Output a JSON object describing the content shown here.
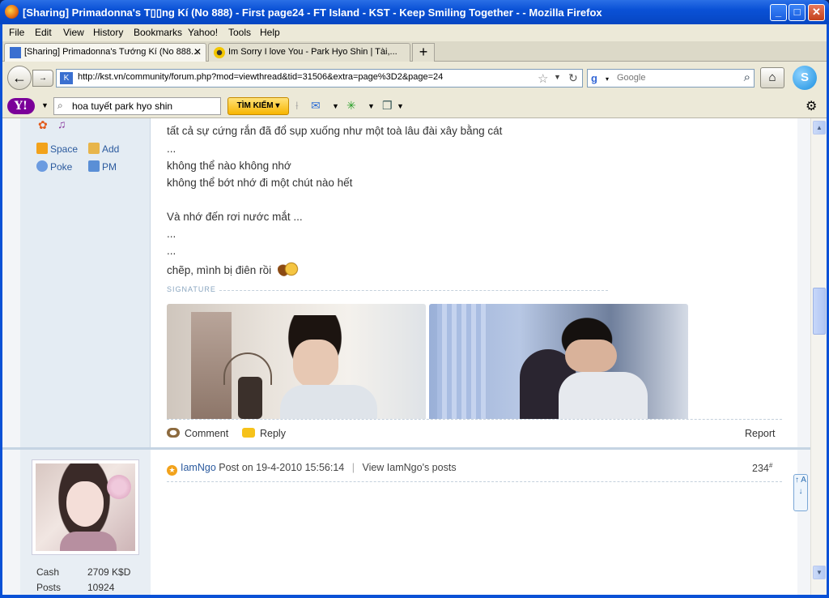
{
  "window": {
    "title": "[Sharing] Primadonna's T▯▯ng Kí (No 888) - First page24 - FT Island - KST - Keep Smiling Together - - Mozilla Firefox",
    "minimize": "_",
    "maximize": "□",
    "close": "✕"
  },
  "menu": [
    "File",
    "Edit",
    "View",
    "History",
    "Bookmarks",
    "Yahoo!",
    "Tools",
    "Help"
  ],
  "tabs": [
    {
      "label": "[Sharing] Primadonna's Tướng Kí (No 888...",
      "active": true
    },
    {
      "label": "Im Sorry I love You - Park Hyo Shin | Tài,...",
      "active": false
    }
  ],
  "nav": {
    "url": "http://kst.vn/community/forum.php?mod=viewthread&tid=31506&extra=page%3D2&page=24",
    "search_placeholder": "Google"
  },
  "yahoo": {
    "logo": "Y!",
    "search_value": "hoa tuyết park hyo shin",
    "search_button": "TÌM KIẾM ▾"
  },
  "sidebar": {
    "links": [
      {
        "label": "Space",
        "icon": "home-icon"
      },
      {
        "label": "Add",
        "icon": "handshake-icon"
      },
      {
        "label": "Poke",
        "icon": "poke-icon"
      },
      {
        "label": "PM",
        "icon": "mail-icon"
      }
    ]
  },
  "post": {
    "lines": [
      "tất cả sự cứng rắn đã đổ sụp xuống như một toà lâu đài xây bằng cát",
      "...",
      "không thể nào không nhớ",
      "không thể bớt nhớ đi một chút nào hết",
      "Và nhớ đến rơi nước mắt ...",
      "...",
      "...",
      "chẽp, mình bị điên rồi"
    ],
    "signature_label": "SIGNATURE",
    "actions": {
      "comment": "Comment",
      "reply": "Reply",
      "report": "Report"
    }
  },
  "next_post": {
    "author": "IamNgo",
    "posted": "Post on 19-4-2010 15:56:14",
    "view_posts": "View IamNgo's posts",
    "floor": "234",
    "floor_suffix": "#",
    "stats": [
      {
        "label": "Cash",
        "value": "2709 K$D"
      },
      {
        "label": "Posts",
        "value": "10924"
      }
    ]
  },
  "side_button": "↑ A ↓"
}
